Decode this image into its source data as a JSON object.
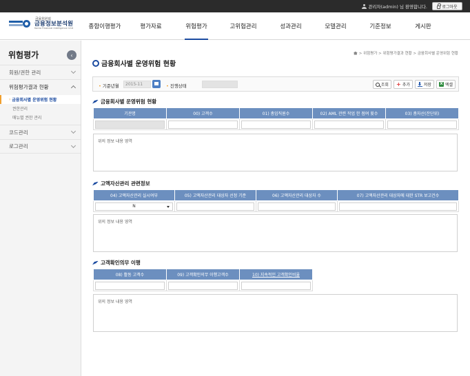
{
  "topbar": {
    "user_text": "관리자(admin) 님 환영합니다.",
    "logout_label": "로그아웃"
  },
  "logo": {
    "sup": "금융위원회",
    "name": "금융정보분석원",
    "eng": "Korea Financial Intelligence Unit"
  },
  "gnb": [
    {
      "label": "종합이행평가",
      "active": false
    },
    {
      "label": "평가자료",
      "active": false
    },
    {
      "label": "위험평가",
      "active": true
    },
    {
      "label": "고위험관리",
      "active": false
    },
    {
      "label": "성과관리",
      "active": false
    },
    {
      "label": "모델관리",
      "active": false
    },
    {
      "label": "기준정보",
      "active": false
    },
    {
      "label": "게시판",
      "active": false
    }
  ],
  "sidebar": {
    "title": "위험평가",
    "items": [
      {
        "label": "회원/권한 관리"
      },
      {
        "label": "위험평가결과 현황"
      },
      {
        "label": "코드관리"
      },
      {
        "label": "로그관리"
      }
    ],
    "sub_items": [
      {
        "label": "금융회사별 운영위험 현황"
      },
      {
        "label": "권한관리"
      },
      {
        "label": "매뉴별 권한 관리"
      }
    ]
  },
  "breadcrumb": {
    "path": "> 위험평가 > 위험평가결과 현황 > 금융회사별 운영위험 현황"
  },
  "page": {
    "title": "금융회사별 운영위험 현황"
  },
  "search": {
    "year_label": "기준년월",
    "year_value": "2015-11",
    "status_label": "진행상태",
    "buttons": {
      "search": "조회",
      "add": "추가",
      "save": "저장",
      "excel": "엑셀"
    }
  },
  "section1": {
    "title": "금융회사별 운영위험 현황",
    "headers": [
      "기관명",
      "00) 고객수",
      "01) 총임직원수",
      "02) AML 관련 작업 한 점여 횟수",
      "03) 총자산(잔단위)"
    ],
    "info": "위의 정보 내용 영역"
  },
  "section2": {
    "title": "고액자산관리 관련정보",
    "headers": [
      "04) 고액자산관리 실시여부",
      "05) 고액자산관리 대상자 선정 기준",
      "06) 고액자산관리 대상자 수",
      "07) 고액자산관리 대상자에 대한 STR 보고건수"
    ],
    "select_value": "N",
    "info": "위의 정보 내용 영역"
  },
  "section3": {
    "title": "고객확인의무 이행",
    "headers": [
      "08) 활동 고객수",
      "09) 고객확인의무 이행고객수",
      "10) 지속적인 고객확인비율"
    ],
    "info": "위의 정보 내용 영역"
  }
}
